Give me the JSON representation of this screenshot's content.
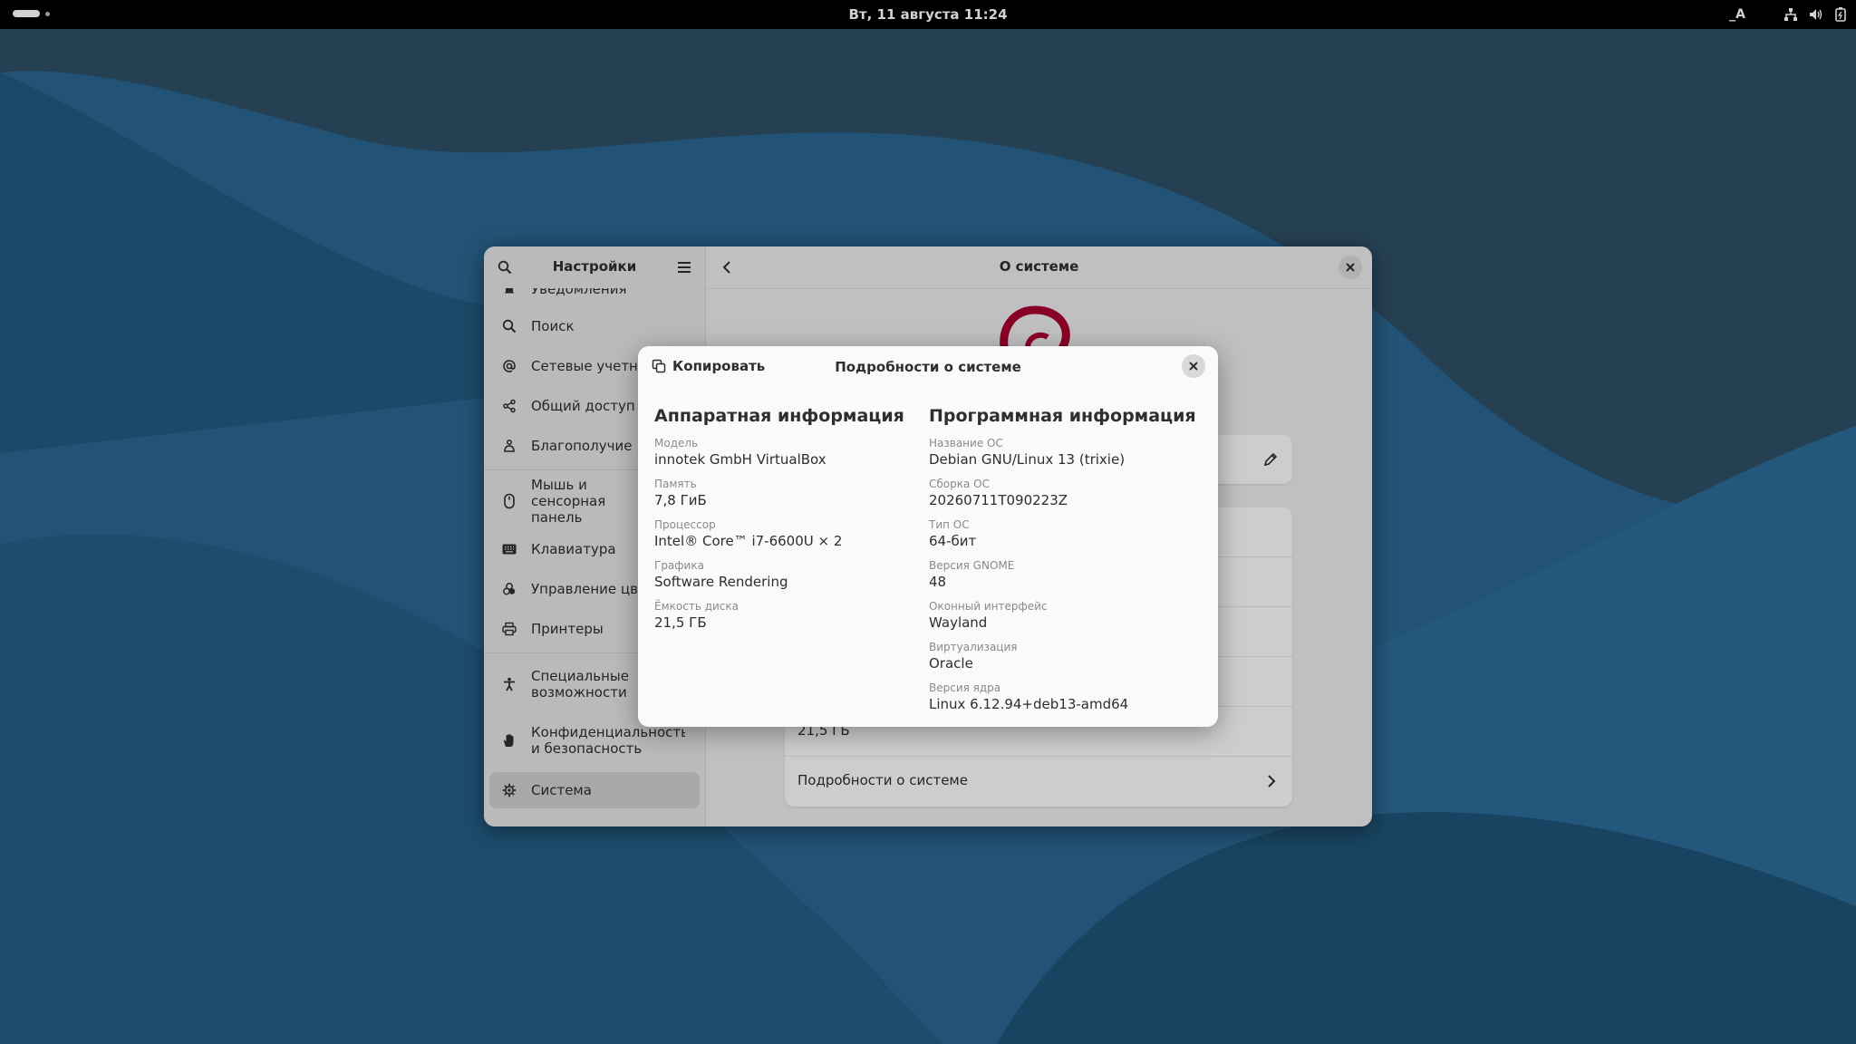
{
  "topbar": {
    "clock": "Вт, 11 августа  11:24",
    "lang": "_A",
    "icons": [
      "network-icon",
      "volume-icon",
      "battery-icon"
    ]
  },
  "settings": {
    "sidebar_title": "Настройки",
    "content_title": "О системе",
    "sidebar_items": [
      {
        "label": "Уведомления",
        "icon": "bell-icon"
      },
      {
        "label": "Поиск",
        "icon": "search-icon"
      },
      {
        "label": "Сетевые учетные з",
        "icon": "at-icon"
      },
      {
        "label": "Общий доступ",
        "icon": "share-icon"
      },
      {
        "label": "Благополучие",
        "icon": "wellbeing-icon"
      },
      {
        "label": "Мышь и сенсорная панель",
        "icon": "mouse-icon"
      },
      {
        "label": "Клавиатура",
        "icon": "keyboard-icon"
      },
      {
        "label": "Управление цвето",
        "icon": "color-icon"
      },
      {
        "label": "Принтеры",
        "icon": "printer-icon"
      },
      {
        "label": "Специальные возможности",
        "icon": "accessibility-icon"
      },
      {
        "label": "Конфиденциальность и безопасность",
        "icon": "hand-icon"
      },
      {
        "label": "Система",
        "icon": "gear-icon",
        "active": true
      }
    ],
    "disk_value": "21,5 ГБ",
    "details_row": "Подробности о системе"
  },
  "dialog": {
    "copy_label": "Копировать",
    "title": "Подробности о системе",
    "hardware": {
      "title": "Аппаратная информация",
      "fields": [
        {
          "key": "Модель",
          "value": "innotek GmbH VirtualBox"
        },
        {
          "key": "Память",
          "value": "7,8 ГиБ"
        },
        {
          "key": "Процессор",
          "value": "Intel® Core™ i7-6600U × 2"
        },
        {
          "key": "Графика",
          "value": "Software Rendering"
        },
        {
          "key": "Ёмкость диска",
          "value": "21,5 ГБ"
        }
      ]
    },
    "software": {
      "title": "Программная информация",
      "fields": [
        {
          "key": "Название ОС",
          "value": "Debian GNU/Linux 13 (trixie)"
        },
        {
          "key": "Сборка ОС",
          "value": "20260711T090223Z"
        },
        {
          "key": "Тип ОС",
          "value": "64-бит"
        },
        {
          "key": "Версия GNOME",
          "value": "48"
        },
        {
          "key": "Оконный интерфейс",
          "value": "Wayland"
        },
        {
          "key": "Виртуализация",
          "value": "Oracle"
        },
        {
          "key": "Версия ядра",
          "value": "Linux 6.12.94+deb13-amd64"
        }
      ]
    }
  },
  "colors": {
    "debian_red": "#a80030",
    "wallpaper_dark": "#1f5479",
    "wallpaper_light": "#2b6d99"
  }
}
